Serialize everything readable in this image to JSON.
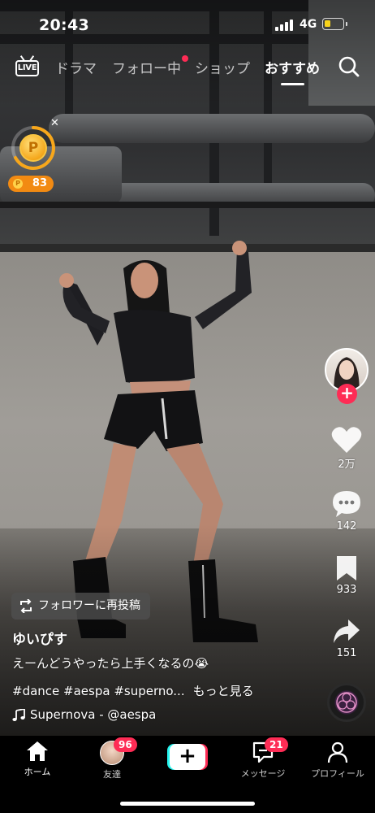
{
  "status_bar": {
    "time": "20:43",
    "network": "4G"
  },
  "top_tabs": {
    "live_label": "LIVE",
    "tabs": [
      {
        "label": "ドラマ",
        "active": false
      },
      {
        "label": "フォロー中",
        "active": false,
        "has_dot": true
      },
      {
        "label": "ショップ",
        "active": false
      },
      {
        "label": "おすすめ",
        "active": true
      }
    ]
  },
  "reward": {
    "coin_symbol": "P",
    "points": "83"
  },
  "actions": {
    "likes": "2万",
    "comments": "142",
    "saves": "933",
    "shares": "151"
  },
  "post": {
    "repost_label": "フォロワーに再投稿",
    "username": "ゆいぴす",
    "description": "えーんどうやったら上手くなるの😭",
    "hashtags": "#dance #aespa #superno...",
    "see_more": "もっと見る",
    "music": "Supernova - @aespa"
  },
  "bottom_nav": {
    "home": "ホーム",
    "friends": "友達",
    "friends_badge": "96",
    "create": "+",
    "inbox": "メッセージ",
    "inbox_badge": "21",
    "profile": "プロフィール"
  },
  "colors": {
    "accent": "#fe2c55",
    "cyan": "#25f4ee",
    "coin": "#f28a12"
  }
}
